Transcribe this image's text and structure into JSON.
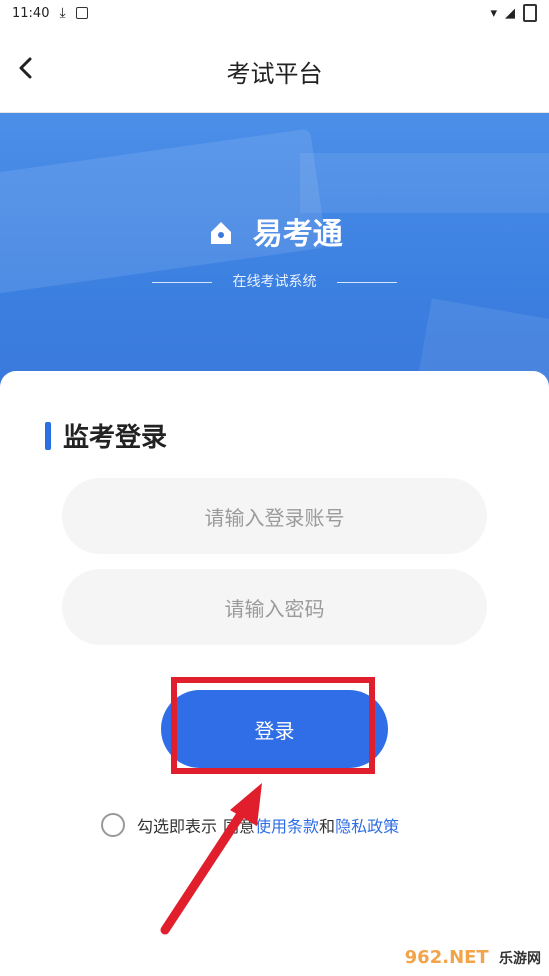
{
  "status": {
    "time": "11:40"
  },
  "header": {
    "title": "考试平台"
  },
  "hero": {
    "brand": "易考通",
    "subtitle": "在线考试系统"
  },
  "login": {
    "section_title": "监考登录",
    "account_placeholder": "请输入登录账号",
    "password_placeholder": "请输入密码",
    "button_label": "登录"
  },
  "agreement": {
    "prefix": "勾选即表示",
    "middle": "同意",
    "terms": "使用条款",
    "and": "和",
    "privacy": "隐私政策"
  },
  "watermark": {
    "brand": "962.NET",
    "small": "乐游网"
  },
  "colors": {
    "primary": "#2f6ee6",
    "highlight": "#e11f2c"
  }
}
